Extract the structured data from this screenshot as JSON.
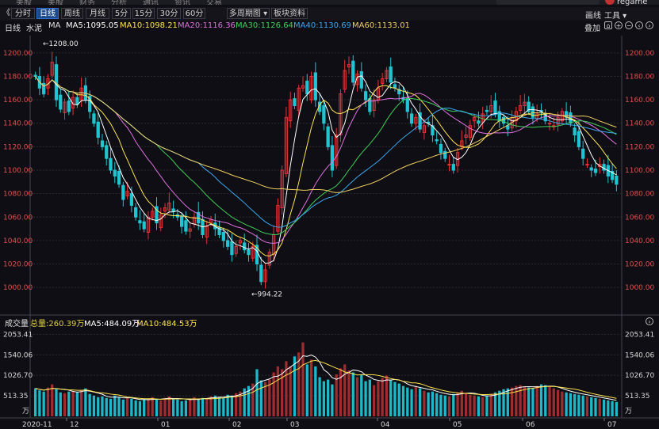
{
  "top_menu": [
    "美股",
    "美股",
    "财务",
    "分析",
    "通讯",
    "资讯",
    "交易"
  ],
  "toolbar": {
    "back": "《",
    "periods": [
      "分时",
      "日线",
      "周线",
      "月线",
      "5分",
      "15分",
      "30分",
      "60分"
    ],
    "active_period": "日线",
    "multi_period": "多周期图",
    "sector": "板块资料",
    "draw": "画线",
    "tools": "工具",
    "user": "regame"
  },
  "info": {
    "period": "日线",
    "stock": "水泥",
    "ma_label": "MA",
    "ma5": "MA5:1095.05",
    "ma10": "MA10:1098.21",
    "ma20": "MA20:1116.36",
    "ma30": "MA30:1126.64",
    "ma40": "MA40:1130.69",
    "ma60": "MA60:1133.01",
    "overlay": "叠加"
  },
  "colors": {
    "up": "#e0343a",
    "down": "#21c4d0",
    "ma5": "#ffffff",
    "ma10": "#ffe44d",
    "ma20": "#e070e0",
    "ma30": "#3fcf5a",
    "ma40": "#38a8f0",
    "ma60": "#f0d060",
    "axis_text": "#e05050",
    "grid": "#2a2a34"
  },
  "volume_info": {
    "label": "成交量",
    "total": "总量:260.39万",
    "ma5": "MA5:484.09万",
    "ma10": "MA10:484.53万"
  },
  "chart_data": {
    "type": "candlestick",
    "price_axis": {
      "ticks": [
        "1200.00",
        "1180.00",
        "1160.00",
        "1140.00",
        "1120.00",
        "1100.00",
        "1080.00",
        "1060.00",
        "1040.00",
        "1020.00",
        "1000.00"
      ],
      "range": [
        990,
        1210
      ]
    },
    "annotations": {
      "high": "1208.00",
      "low": "994.22"
    },
    "volume_axis": {
      "ticks": [
        "2053.41",
        "1540.06",
        "1026.70",
        "513.35"
      ],
      "unit": "万",
      "range": [
        0,
        2100
      ]
    },
    "x_labels": [
      "2020-11",
      "12",
      "01",
      "02",
      "03",
      "04",
      "05",
      "06",
      "07"
    ],
    "closes": [
      1180,
      1170,
      1165,
      1178,
      1192,
      1160,
      1152,
      1158,
      1150,
      1162,
      1156,
      1170,
      1160,
      1150,
      1140,
      1128,
      1120,
      1110,
      1100,
      1095,
      1088,
      1075,
      1082,
      1070,
      1060,
      1055,
      1050,
      1060,
      1065,
      1055,
      1062,
      1068,
      1072,
      1065,
      1060,
      1052,
      1048,
      1050,
      1060,
      1055,
      1045,
      1052,
      1058,
      1050,
      1045,
      1040,
      1035,
      1028,
      1035,
      1040,
      1032,
      1028,
      1035,
      1020,
      1005,
      1015,
      1030,
      1045,
      1070,
      1100,
      1145,
      1160,
      1155,
      1170,
      1172,
      1165,
      1180,
      1160,
      1150,
      1140,
      1120,
      1100,
      1130,
      1165,
      1185,
      1190,
      1175,
      1182,
      1170,
      1160,
      1150,
      1160,
      1170,
      1178,
      1185,
      1175,
      1170,
      1165,
      1160,
      1150,
      1140,
      1145,
      1135,
      1138,
      1140,
      1130,
      1125,
      1115,
      1110,
      1105,
      1100,
      1115,
      1125,
      1130,
      1138,
      1145,
      1140,
      1148,
      1150,
      1155,
      1148,
      1142,
      1140,
      1135,
      1145,
      1150,
      1155,
      1158,
      1150,
      1145,
      1148,
      1150,
      1142,
      1140,
      1138,
      1145,
      1150,
      1145,
      1140,
      1130,
      1120,
      1110,
      1105,
      1100,
      1098,
      1105,
      1100,
      1095,
      1092,
      1088
    ],
    "volumes": [
      700,
      650,
      620,
      720,
      800,
      680,
      600,
      580,
      620,
      640,
      600,
      660,
      700,
      560,
      520,
      480,
      500,
      460,
      440,
      520,
      480,
      420,
      460,
      440,
      400,
      380,
      420,
      440,
      480,
      420,
      400,
      460,
      500,
      450,
      420,
      380,
      400,
      440,
      480,
      420,
      460,
      440,
      500,
      520,
      480,
      460,
      540,
      520,
      580,
      620,
      700,
      760,
      820,
      1180,
      900,
      860,
      920,
      1100,
      1250,
      1180,
      1380,
      1250,
      1500,
      1600,
      1850,
      1300,
      1420,
      1250,
      980,
      880,
      920,
      800,
      1050,
      1200,
      1300,
      1150,
      1100,
      980,
      1050,
      880,
      920,
      780,
      880,
      960,
      1020,
      900,
      860,
      820,
      760,
      720,
      680,
      760,
      700,
      640,
      600,
      620,
      580,
      540,
      520,
      500,
      560,
      600,
      640,
      580,
      540,
      520,
      500,
      480,
      520,
      560,
      600,
      640,
      680,
      700,
      720,
      760,
      780,
      740,
      720,
      700,
      760,
      800,
      780,
      740,
      700,
      660,
      620,
      600,
      580,
      560,
      540,
      520,
      500,
      480,
      460,
      440,
      420,
      400,
      380,
      360
    ],
    "vol_ma5_last": "484.09",
    "vol_ma10_last": "484.53"
  }
}
